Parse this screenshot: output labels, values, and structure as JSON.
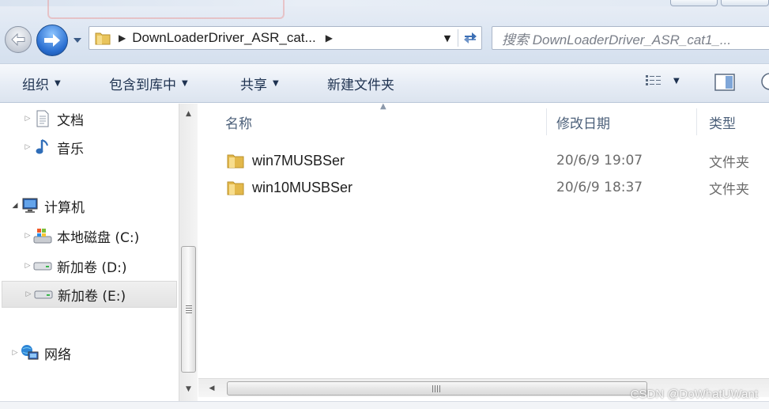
{
  "address_bar": {
    "path_crumb": "DownLoaderDriver_ASR_cat...",
    "search_placeholder": "搜索 DownLoaderDriver_ASR_cat1_..."
  },
  "toolbar": {
    "organize": "组织",
    "include_in_library": "包含到库中",
    "share": "共享",
    "new_folder": "新建文件夹"
  },
  "nav_tree": {
    "documents": "文档",
    "music": "音乐",
    "computer": "计算机",
    "drive_c": "本地磁盘 (C:)",
    "drive_d": "新加卷 (D:)",
    "drive_e": "新加卷 (E:)",
    "network": "网络"
  },
  "columns": {
    "name": "名称",
    "modified": "修改日期",
    "type": "类型"
  },
  "files": [
    {
      "name": "win7MUSBSer",
      "modified": "20/6/9 19:07",
      "type": "文件夹"
    },
    {
      "name": "win10MUSBSer",
      "modified": "20/6/9 18:37",
      "type": "文件夹"
    }
  ],
  "scrollbar": {
    "grip": "III"
  },
  "watermark": "CSDN @DoWhatUWant",
  "icons": {
    "back": "back-arrow-icon",
    "forward": "forward-arrow-icon",
    "folder": "folder-icon",
    "refresh": "refresh-icon",
    "view": "view-options-icon",
    "preview": "preview-pane-icon"
  },
  "colors": {
    "toolbar_text": "#1e3250",
    "column_header": "#4c607a",
    "folder": "#e9c45b",
    "forward_button": "#2a6fd1"
  }
}
